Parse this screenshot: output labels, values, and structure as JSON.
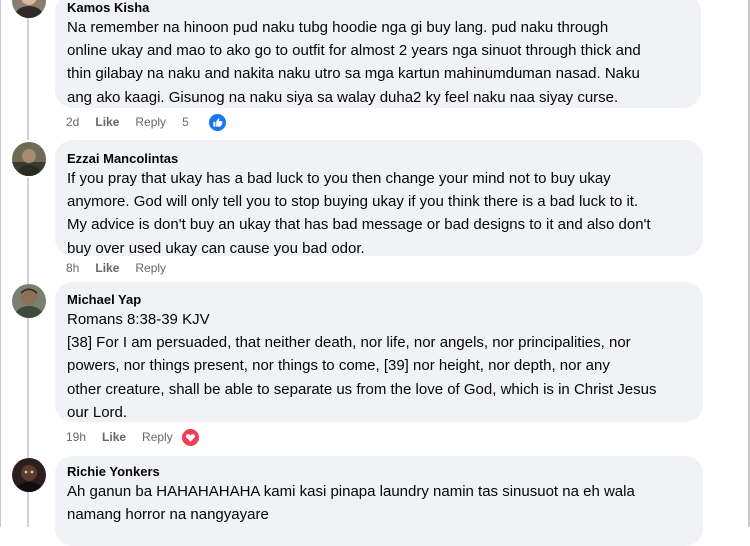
{
  "colors": {
    "bubble_bg": "#f0f2f5",
    "meta_text": "#65676b",
    "like_blue": "#1877f2",
    "love_red": "#f33e58"
  },
  "comments": [
    {
      "author": "Kamos Kisha",
      "lines": [
        "Na remember na hinoon pud naku tubg hoodie nga gi buy lang. pud naku through",
        "online ukay and mao to ako go to outfit for almost 2 years nga sinuot through thick and",
        "thin gilabay na naku and nakita naku utro sa mga kartun mahinumduman nasad. Naku",
        "ang ako kaagi. Gisunog na naku siya sa walay duha2 ky feel naku naa siyay curse."
      ],
      "time": "2d",
      "like_label": "Like",
      "reply_label": "Reply",
      "reaction_count": "5",
      "reaction_icon": "like-thumb-icon"
    },
    {
      "author": "Ezzai Mancolintas",
      "lines": [
        "If you pray that ukay has a bad luck to you then change your mind not to buy ukay",
        "anymore. God will only tell you to stop buying ukay if you think there is a bad luck to it.",
        "My advice is don't buy an ukay that has bad message or bad designs to it and also don't",
        "buy over used ukay can cause you bad odor."
      ],
      "time": "8h",
      "like_label": "Like",
      "reply_label": "Reply"
    },
    {
      "author": "Michael Yap",
      "lines": [
        "Romans 8:38-39 KJV",
        "[38] For I am persuaded, that neither death, nor life, nor angels, nor principalities, nor",
        "powers, nor things present, nor things to come, [39] nor height, nor depth, nor any",
        "other creature, shall be able to separate us from the love of God, which is in Christ Jesus",
        "our Lord."
      ],
      "time": "19h",
      "like_label": "Like",
      "reply_label": "Reply",
      "reaction_icon": "love-heart-icon"
    },
    {
      "author": "Richie Yonkers",
      "lines": [
        "Ah ganun ba HAHAHAHAHA kami kasi pinapa laundry namin tas sinusuot na eh wala",
        "namang horror na nangyayare"
      ]
    }
  ]
}
